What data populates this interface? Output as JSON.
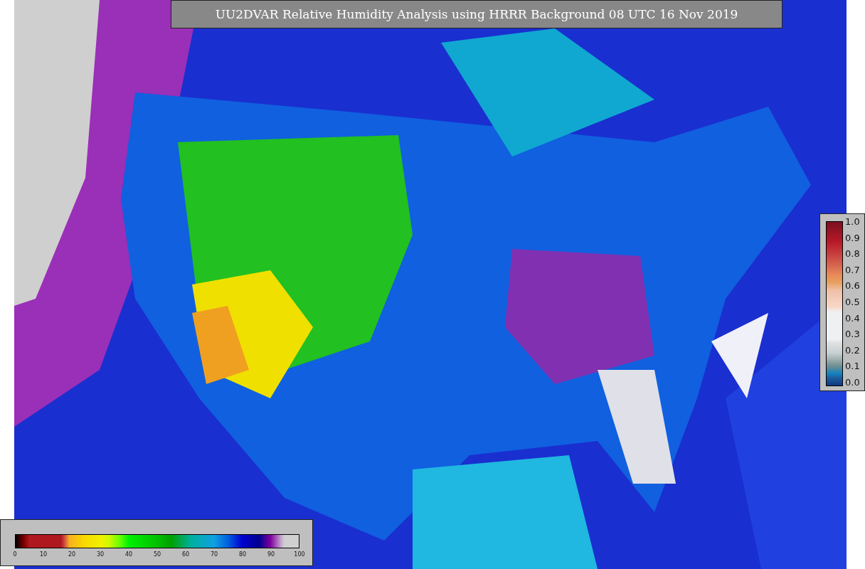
{
  "title": "UU2DVAR Relative Humidity Analysis using HRRR Background 08 UTC 16 Nov 2019",
  "humidity_colorbar": {
    "ticks": [
      "0",
      "10",
      "20",
      "30",
      "40",
      "50",
      "60",
      "70",
      "80",
      "90",
      "100"
    ]
  },
  "observation_colorbar": {
    "ticks": [
      "1.0",
      "0.9",
      "0.8",
      "0.7",
      "0.6",
      "0.5",
      "0.4",
      "0.3",
      "0.2",
      "0.1",
      "0.0"
    ]
  }
}
